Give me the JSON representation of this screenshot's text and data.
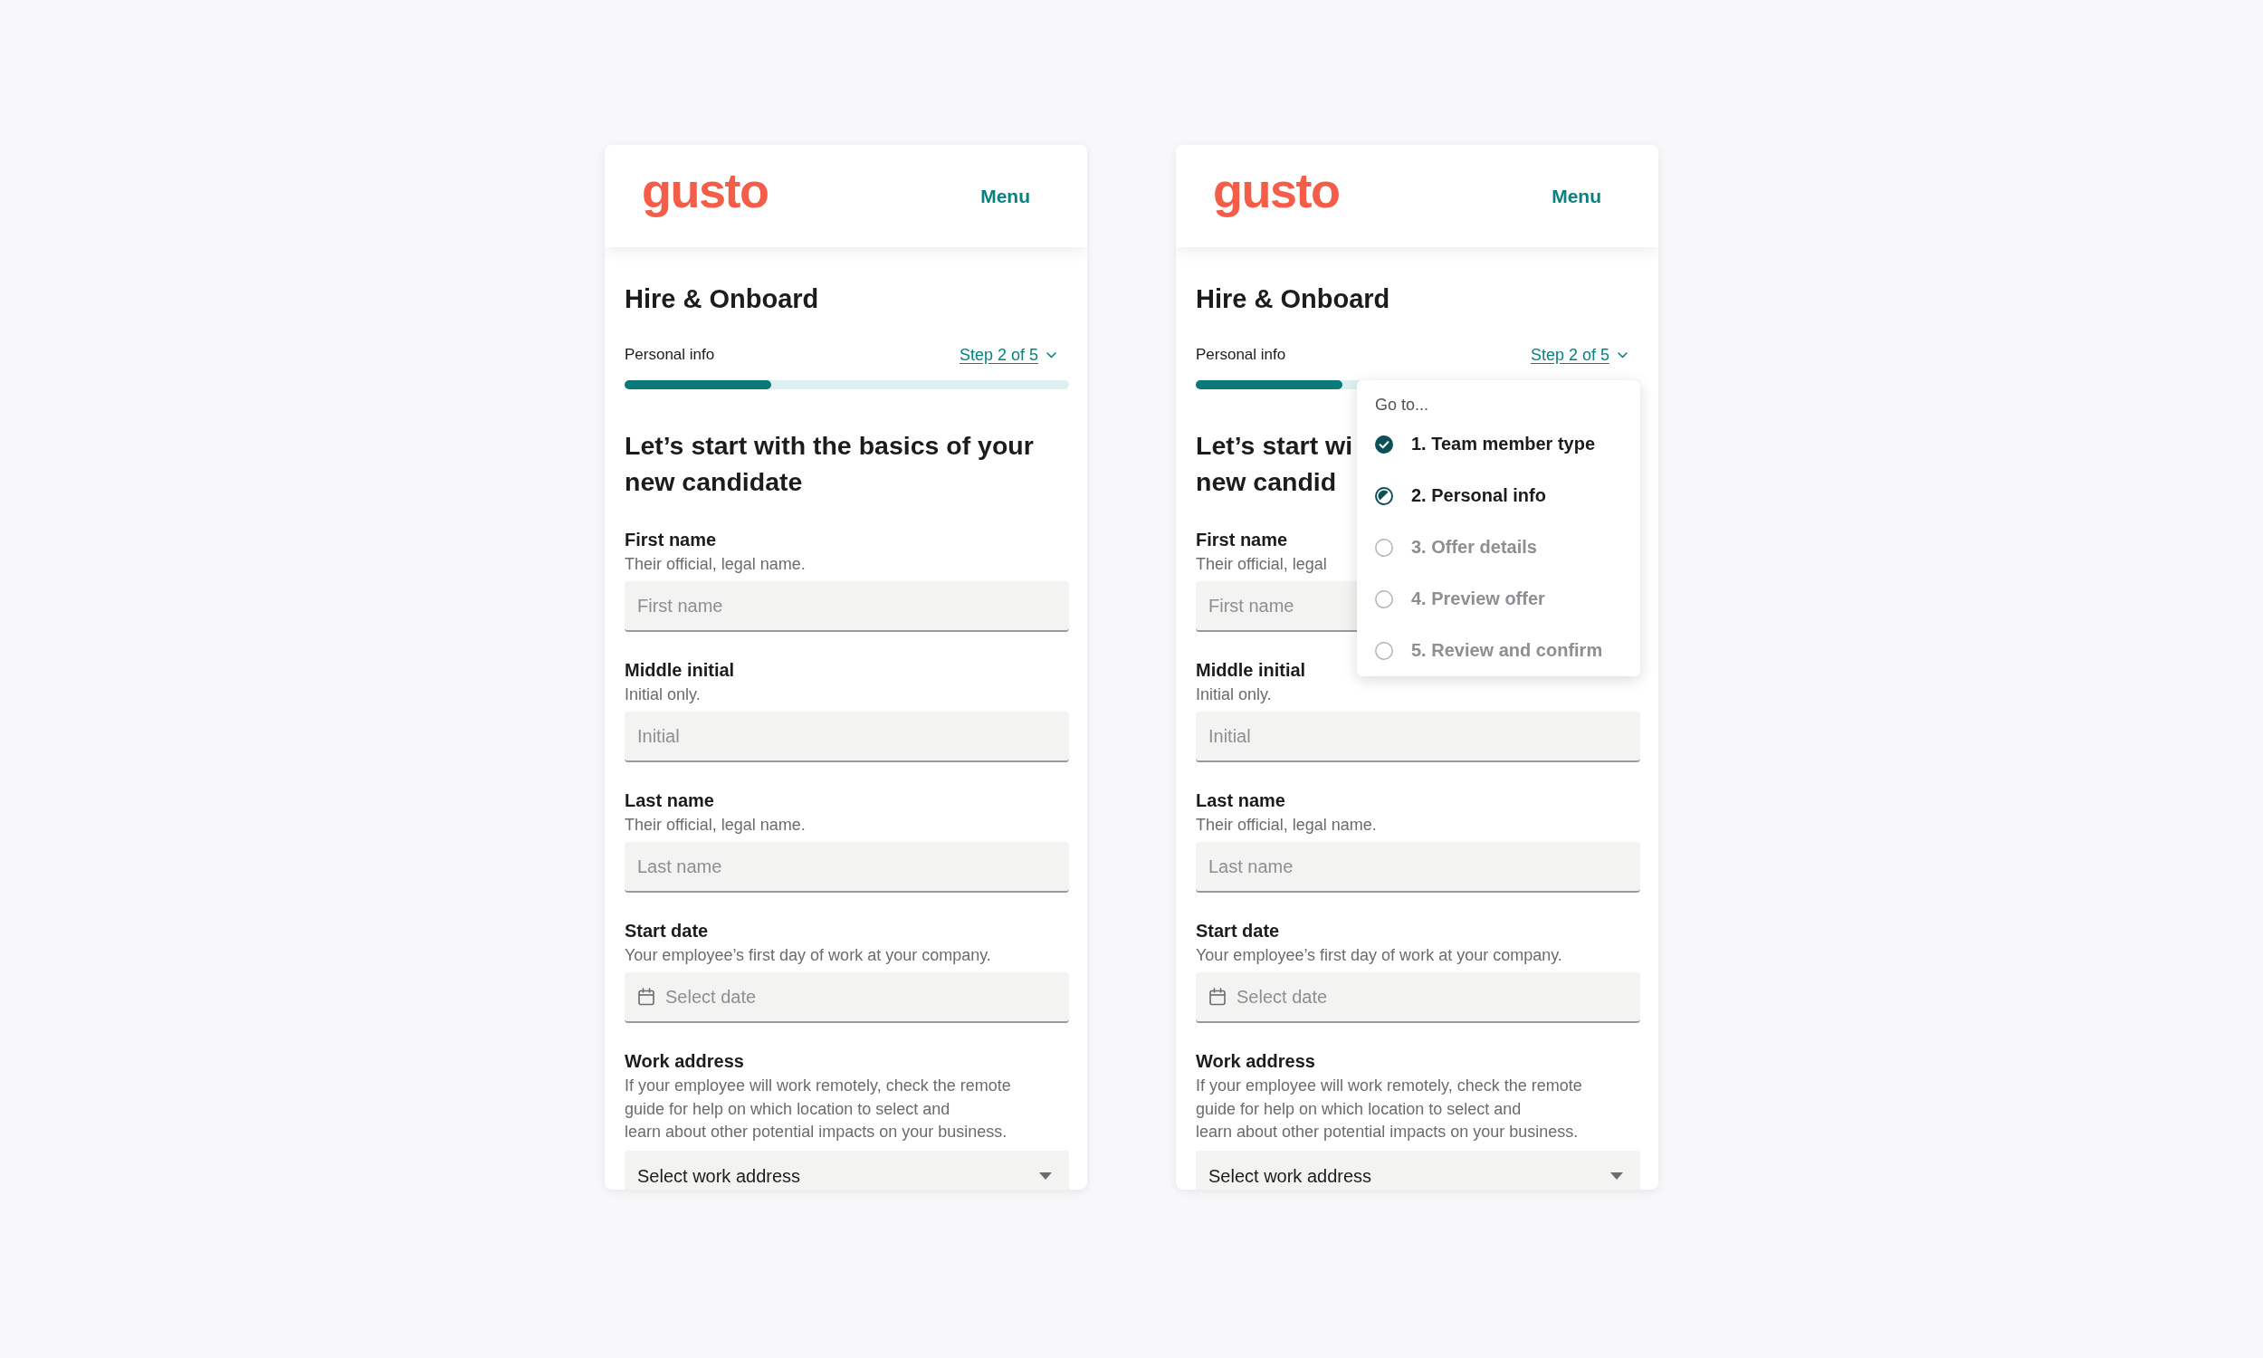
{
  "screens": [
    {
      "header": {
        "logo": "gusto",
        "menu": "Menu"
      },
      "title": "Hire & Onboard",
      "step": {
        "name": "Personal info",
        "link": "Step 2 of 5",
        "level": 0.33
      },
      "heading_lines": [
        "Let’s start with the basics of your",
        "new candidate"
      ],
      "fields": [
        {
          "kind": "text",
          "label": "First name",
          "hint": "Their official, legal name.",
          "placeholder": "First name"
        },
        {
          "kind": "text",
          "label": "Middle initial",
          "hint": "Initial only.",
          "placeholder": "Initial"
        },
        {
          "kind": "text",
          "label": "Last name",
          "hint": "Their official, legal name.",
          "placeholder": "Last name"
        },
        {
          "kind": "date",
          "label": "Start date",
          "hint": "Your employee’s first day of work at your company.",
          "placeholder": "Select date"
        },
        {
          "kind": "select",
          "label": "Work address",
          "hint": "If your employee will work remotely, check the remote\nguide for help on which location to select and\nlearn about other potential impacts on your business.",
          "value": "Select work address"
        }
      ]
    },
    {
      "header": {
        "logo": "gusto",
        "menu": "Menu"
      },
      "title": "Hire & Onboard",
      "step": {
        "name": "Personal info",
        "link": "Step 2 of 5",
        "level": 0.33
      },
      "heading_lines": [
        "Let’s start wi",
        "new candid"
      ],
      "fields": [
        {
          "kind": "text",
          "label": "First name",
          "hint": "Their official, legal",
          "placeholder": "First name"
        },
        {
          "kind": "text",
          "label": "Middle initial",
          "hint": "Initial only.",
          "placeholder": "Initial"
        },
        {
          "kind": "text",
          "label": "Last name",
          "hint": "Their official, legal name.",
          "placeholder": "Last name"
        },
        {
          "kind": "date",
          "label": "Start date",
          "hint": "Your employee’s first day of work at your company.",
          "placeholder": "Select date"
        },
        {
          "kind": "select",
          "label": "Work address",
          "hint": "If your employee will work remotely, check the remote\nguide for help on which location to select and\nlearn about other potential impacts on your business.",
          "value": "Select work address"
        }
      ],
      "step_menu": {
        "title": "Go to...",
        "items": [
          {
            "label": "1. Team member type",
            "completed": true,
            "selected": false
          },
          {
            "label": "2. Personal info",
            "completed": false,
            "selected": true
          },
          {
            "label": "3. Offer details",
            "completed": false,
            "selected": false
          },
          {
            "label": "4. Preview offer",
            "completed": false,
            "selected": false
          },
          {
            "label": "5. Review and confirm",
            "completed": false,
            "selected": false
          }
        ]
      }
    }
  ]
}
